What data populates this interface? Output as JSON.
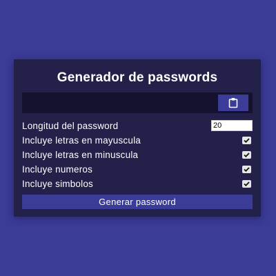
{
  "title": "Generador de passwords",
  "result": {
    "value": ""
  },
  "clipboard_icon": "clipboard-icon",
  "settings": {
    "length": {
      "label": "Longitud del password",
      "value": "20"
    },
    "uppercase": {
      "label": "Incluye letras en mayuscula",
      "checked": true
    },
    "lowercase": {
      "label": "Incluye letras en minuscula",
      "checked": true
    },
    "numbers": {
      "label": "Incluye numeros",
      "checked": true
    },
    "symbols": {
      "label": "Incluye simbolos",
      "checked": true
    }
  },
  "generate_label": "Generar password",
  "colors": {
    "background": "#3b3b98",
    "card": "#23204a",
    "result_bg": "#14122f"
  }
}
